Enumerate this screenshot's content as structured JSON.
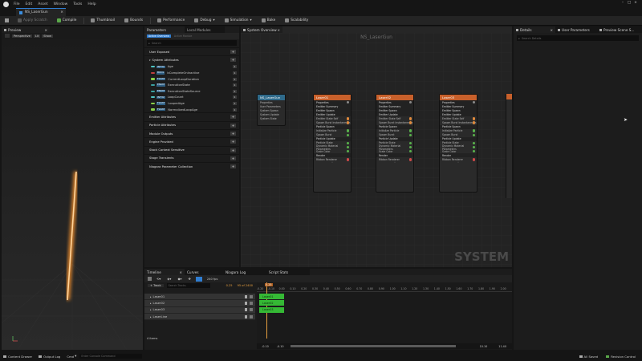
{
  "menu": [
    "File",
    "Edit",
    "Asset",
    "Window",
    "Tools",
    "Help"
  ],
  "tab": {
    "title": "NS_LaserGun"
  },
  "toolbar": {
    "apply": "Apply Scratch",
    "compile": "Compile",
    "thumbnail": "Thumbnail",
    "bounds": "Bounds",
    "performance": "Performance",
    "debug": "Debug",
    "simulation": "Simulation",
    "bake": "Bake",
    "scalability": "Scalability"
  },
  "preview": {
    "tab": "Preview",
    "perspective": "Perspective",
    "lit": "Lit",
    "show": "Show"
  },
  "parameters": {
    "tab": "Parameters",
    "local_modules": "Local Modules",
    "sub_tab_active": "Active Overview",
    "sub_tab_other": "Active Module",
    "search_placeholder": "Search",
    "user_exposed": "User Exposed",
    "system_attributes": "System Attributes",
    "params": [
      {
        "type": "INT32",
        "name": "Age",
        "count": "1"
      },
      {
        "type": "BOOL",
        "name": "bCompleteOnInactive",
        "count": "1"
      },
      {
        "type": "FLOAT",
        "name": "CurrentLoopDuration",
        "count": "1"
      },
      {
        "type": "ENUM",
        "name": "ExecutionState",
        "count": "1"
      },
      {
        "type": "ENUM",
        "name": "ExecutionStateSource",
        "count": "1"
      },
      {
        "type": "INT32",
        "name": "LoopCount",
        "count": "1"
      },
      {
        "type": "FLOAT",
        "name": "LoopedAge",
        "count": "1"
      },
      {
        "type": "FLOAT",
        "name": "NormalizedLoopAge",
        "count": "1"
      }
    ],
    "categories": [
      "Emitter Attributes",
      "Particle Attributes",
      "Module Outputs",
      "Engine Provided",
      "Stack Context Sensitive",
      "Stage Transients",
      "Niagara Parameter Collection"
    ]
  },
  "graph": {
    "tab": "System Overview",
    "title": "NS_LaserGun",
    "watermark": "SYSTEM",
    "system_node": {
      "title": "NS_LaserGun",
      "rows": [
        "Properties",
        "User Parameters",
        "System Spawn",
        "System Update",
        "System State"
      ]
    },
    "emitters": [
      {
        "title": "Laser01"
      },
      {
        "title": "Laser02"
      },
      {
        "title": "Laser03"
      }
    ],
    "emitter_rows": [
      {
        "label": "Properties",
        "sec": true,
        "pin": "#8a8a8a"
      },
      {
        "label": "Emitter Summary",
        "sec": true,
        "pin": ""
      },
      {
        "label": "Emitter Spawn",
        "sec": true,
        "pin": ""
      },
      {
        "label": "Emitter Update",
        "sec": true,
        "pin": ""
      },
      {
        "label": "Emitter State  Self",
        "sec": false,
        "pin": "#e08a3c"
      },
      {
        "label": "Spawn Burst Instantaneous",
        "sec": false,
        "pin": "#e08a3c"
      },
      {
        "label": "Particle Spawn",
        "sec": true,
        "pin": ""
      },
      {
        "label": "Initialize Particle",
        "sec": false,
        "pin": "#59b34c"
      },
      {
        "label": "Spawn Burst",
        "sec": false,
        "pin": "#59b34c"
      },
      {
        "label": "Particle Update",
        "sec": true,
        "pin": ""
      },
      {
        "label": "Particle State",
        "sec": false,
        "pin": "#59b34c"
      },
      {
        "label": "Dynamic Material Parameters",
        "sec": false,
        "pin": "#59b34c"
      },
      {
        "label": "Scale Color",
        "sec": false,
        "pin": "#59b34c"
      },
      {
        "label": "Render",
        "sec": true,
        "pin": ""
      },
      {
        "label": "Ribbon Renderer",
        "sec": false,
        "pin": "#d04a4a"
      }
    ]
  },
  "details": {
    "tab": "Details",
    "user_params": "User Parameters",
    "preview_scene": "Preview Scene S...",
    "search_placeholder": "Search Details"
  },
  "timeline": {
    "tab": "Timeline",
    "curves": "Curves",
    "niagara_log": "Niagara Log",
    "script_stats": "Script Stats",
    "fps": "240 fps",
    "track_btn": "+ Track",
    "search_placeholder": "Search Tracks",
    "time": "0.25",
    "frame": "95 of 2400",
    "tracks": [
      "Laser01",
      "Laser02",
      "Laser03",
      "LaserLine"
    ],
    "items": "4 items",
    "ruler": [
      "-0.20",
      "-0.10",
      "0.00",
      "0.10",
      "0.20",
      "0.30",
      "0.40",
      "0.50",
      "0.60",
      "0.70",
      "0.80",
      "0.90",
      "1.00",
      "1.10",
      "1.20",
      "1.30",
      "1.40",
      "1.50",
      "1.60",
      "1.70",
      "1.80",
      "1.90",
      "2.00"
    ],
    "start": "-0.10",
    "start2": "-0.10",
    "end": "10.10",
    "end2": "11.40",
    "bars": [
      "Laser01",
      "Laser02",
      "Laser03"
    ]
  },
  "status": {
    "content_drawer": "Content Drawer",
    "output_log": "Output Log",
    "cmd": "Cmd",
    "console_placeholder": "Enter Console Command",
    "saved": "All Saved",
    "revision": "Revision Control"
  },
  "colors": {
    "accent": "#2f7dd1",
    "node_header": "#c8602b",
    "green": "#35b935"
  }
}
